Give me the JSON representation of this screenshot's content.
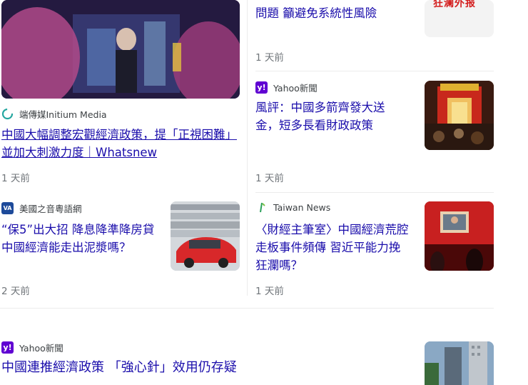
{
  "articles": [
    {
      "source": "端傳媒Initium Media",
      "headline": "中國大幅調整宏觀經濟政策，提「正視困難」並加大刺激力度｜Whatsnew",
      "time": "1 天前"
    },
    {
      "headline": "問題 籲避免系統性風險",
      "time": "1 天前",
      "thumb_text": "狂澜外报"
    },
    {
      "source": "Yahoo新聞",
      "headline": "風評：中國多箭齊發大送金，短多長看財政政策",
      "time": "1 天前"
    },
    {
      "source": "美國之音粵語網",
      "source_logo": "VA",
      "headline": "“保5”出大招 降息降準降房貸 中國經濟能走出泥漿嗎？",
      "time": "2 天前"
    },
    {
      "source": "Taiwan News",
      "headline": "〈財經主筆室〉中國經濟荒腔走板事件頻傳 習近平能力挽狂瀾嗎？",
      "time": "1 天前"
    },
    {
      "source": "Yahoo新聞",
      "headline": "中國連推經濟政策 「強心針」效用仍存疑"
    }
  ],
  "colors": {
    "link": "#1a0dab",
    "meta": "#70757a",
    "yahoo": "#6001d2"
  }
}
